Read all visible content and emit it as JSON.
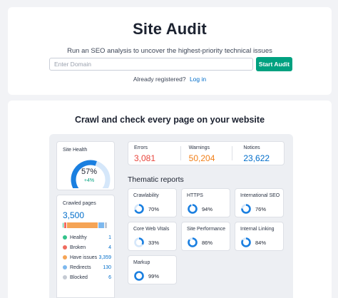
{
  "hero": {
    "title": "Site Audit",
    "subtitle": "Run an SEO analysis to uncover the highest-priority technical issues",
    "domain_input": {
      "value": "",
      "placeholder": "Enter Domain"
    },
    "start_button": "Start Audit",
    "registered_text": "Already registered?",
    "login_link": "Log in"
  },
  "main": {
    "title": "Crawl and check every page on your website"
  },
  "site_health": {
    "label": "Site Health",
    "value": "57%",
    "delta": "+4%",
    "percent": 57
  },
  "issues": [
    {
      "label": "Errors",
      "value": "3,081",
      "color": "#e8453c"
    },
    {
      "label": "Warnings",
      "value": "50,204",
      "color": "#f17f18"
    },
    {
      "label": "Notices",
      "value": "23,622",
      "color": "#006dca"
    }
  ],
  "crawled": {
    "label": "Crawled pages",
    "total": "3,500",
    "items": [
      {
        "name": "Healthy",
        "count": "1",
        "color": "#33c28a",
        "share": 0.02
      },
      {
        "name": "Broken",
        "count": "4",
        "color": "#ef6b5f",
        "share": 0.06
      },
      {
        "name": "Have issues",
        "count": "3,359",
        "color": "#f5a455",
        "share": 0.66
      },
      {
        "name": "Redirects",
        "count": "130",
        "color": "#7db8ee",
        "share": 0.14
      },
      {
        "name": "Blocked",
        "count": "6",
        "color": "#c5cad3",
        "share": 0.06
      }
    ]
  },
  "thematic": {
    "title": "Thematic reports",
    "reports": [
      {
        "name": "Crawlability",
        "value": "70%",
        "percent": 70
      },
      {
        "name": "HTTPS",
        "value": "94%",
        "percent": 94
      },
      {
        "name": "International SEO",
        "value": "76%",
        "percent": 76
      },
      {
        "name": "Core Web Vitals",
        "value": "33%",
        "percent": 33
      },
      {
        "name": "Site Performance",
        "value": "86%",
        "percent": 86
      },
      {
        "name": "Internal Linking",
        "value": "84%",
        "percent": 84
      },
      {
        "name": "Markup",
        "value": "99%",
        "percent": 99
      }
    ]
  },
  "colors": {
    "accent": "#00a180",
    "link": "#006dca",
    "ring": "#1a7fe0",
    "ring_track": "#d5e7fa"
  }
}
